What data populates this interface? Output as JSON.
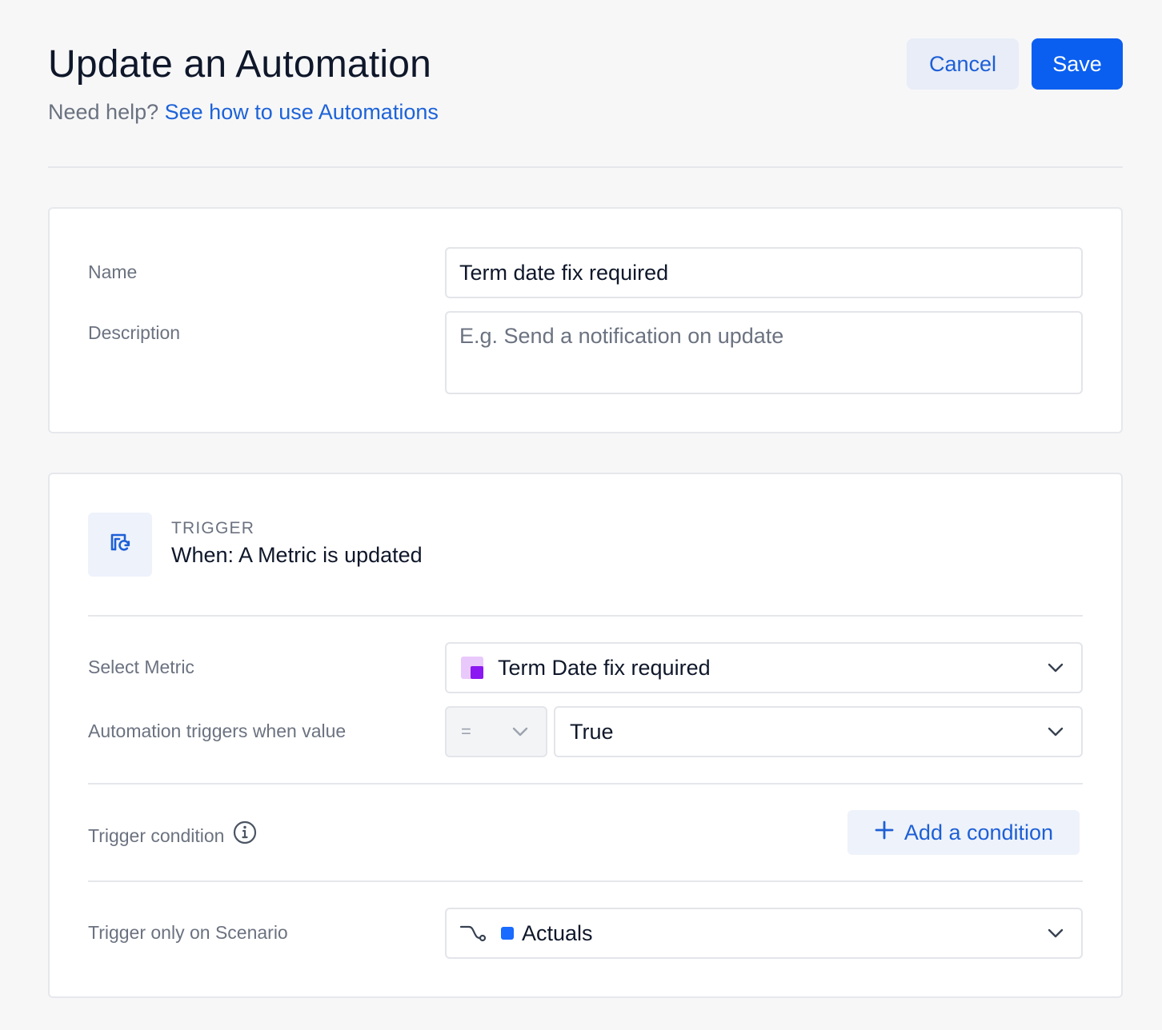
{
  "header": {
    "title": "Update an Automation",
    "help_prefix": "Need help?",
    "help_link": "See how to use Automations",
    "cancel_label": "Cancel",
    "save_label": "Save"
  },
  "details": {
    "name_label": "Name",
    "name_value": "Term date fix required",
    "description_label": "Description",
    "description_placeholder": "E.g. Send a notification on update"
  },
  "trigger": {
    "kicker": "TRIGGER",
    "title": "When: A Metric is updated",
    "icon": "metric-refresh-icon",
    "select_metric_label": "Select Metric",
    "selected_metric": "Term Date fix required",
    "metric_icon": "metric-color-icon",
    "when_value_label": "Automation triggers when value",
    "operator": "=",
    "value": "True",
    "condition_label": "Trigger condition",
    "add_condition_label": "Add a condition",
    "scenario_label": "Trigger only on Scenario",
    "scenario_value": "Actuals",
    "scenario_icon": "branch-icon"
  },
  "colors": {
    "primary": "#0a5ff0",
    "link": "#1d63d8",
    "scenario_dot": "#1a6bff",
    "metric_icon_light": "#e9c9fb",
    "metric_icon_dark": "#8b18f2"
  }
}
